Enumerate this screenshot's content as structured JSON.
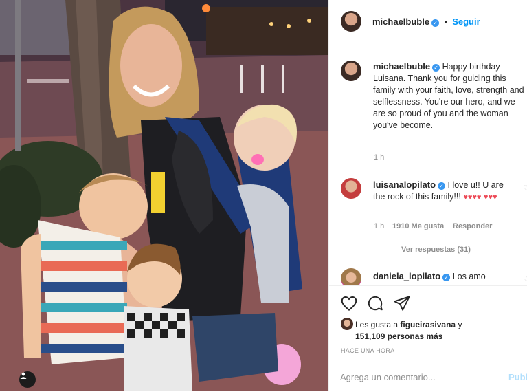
{
  "post": {
    "author": "michaelbuble",
    "follow_label": "Seguir",
    "follow_separator": "•",
    "caption": "Happy birthday Luisana. Thank you for guiding this family with your faith, love, strength and selflessness. You're our hero, and we are so proud of you and the woman you've become.",
    "caption_time": "1 h"
  },
  "comments": [
    {
      "user": "luisanalopilato",
      "text": "I love u!! U are the rock of this family!!!",
      "hearts_line1": "♥♥♥♥",
      "hearts_line2": "♥♥♥",
      "time": "1 h",
      "likes": "1910 Me gusta",
      "reply_label": "Responder",
      "view_replies": "Ver respuestas (31)"
    },
    {
      "user": "daniela_lopilato",
      "text": "Los amo"
    }
  ],
  "actions": {
    "icons": [
      "heart-icon",
      "comment-icon",
      "share-icon"
    ]
  },
  "likes": {
    "prefix": "Les gusta a",
    "user": "figueirasivana",
    "joiner": "y",
    "count": "151,109 personas más"
  },
  "timestamp": "HACE UNA HORA",
  "composer": {
    "placeholder": "Agrega un comentario...",
    "post_label": "Publ"
  },
  "colors": {
    "accent": "#0095f6",
    "verified": "#3897f0",
    "heart": "#ed4956",
    "muted": "#8e8e8e"
  }
}
